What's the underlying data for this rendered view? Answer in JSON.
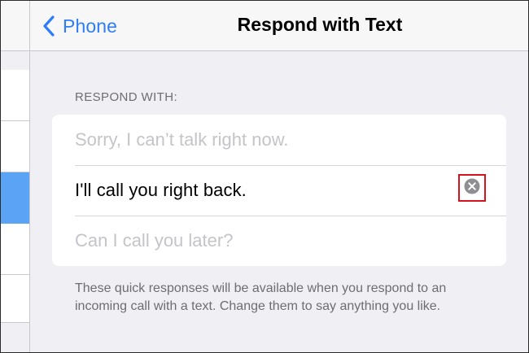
{
  "navbar": {
    "back_label": "Phone",
    "title": "Respond with Text"
  },
  "section": {
    "header": "RESPOND WITH:"
  },
  "responses": [
    {
      "value": "",
      "placeholder": "Sorry, I can’t talk right now."
    },
    {
      "value": "I'll call you right back.",
      "placeholder": ""
    },
    {
      "value": "",
      "placeholder": "Can I call you later?"
    }
  ],
  "footer": {
    "text": "These quick responses will be available when you respond to an incoming call with a text. Change them to say anything you like."
  },
  "colors": {
    "accent": "#2f7df6",
    "highlight_box": "#d6121e",
    "selected_row": "#5aa3f5"
  },
  "icons": {
    "back": "chevron-left-icon",
    "clear": "clear-circle-x-icon"
  }
}
